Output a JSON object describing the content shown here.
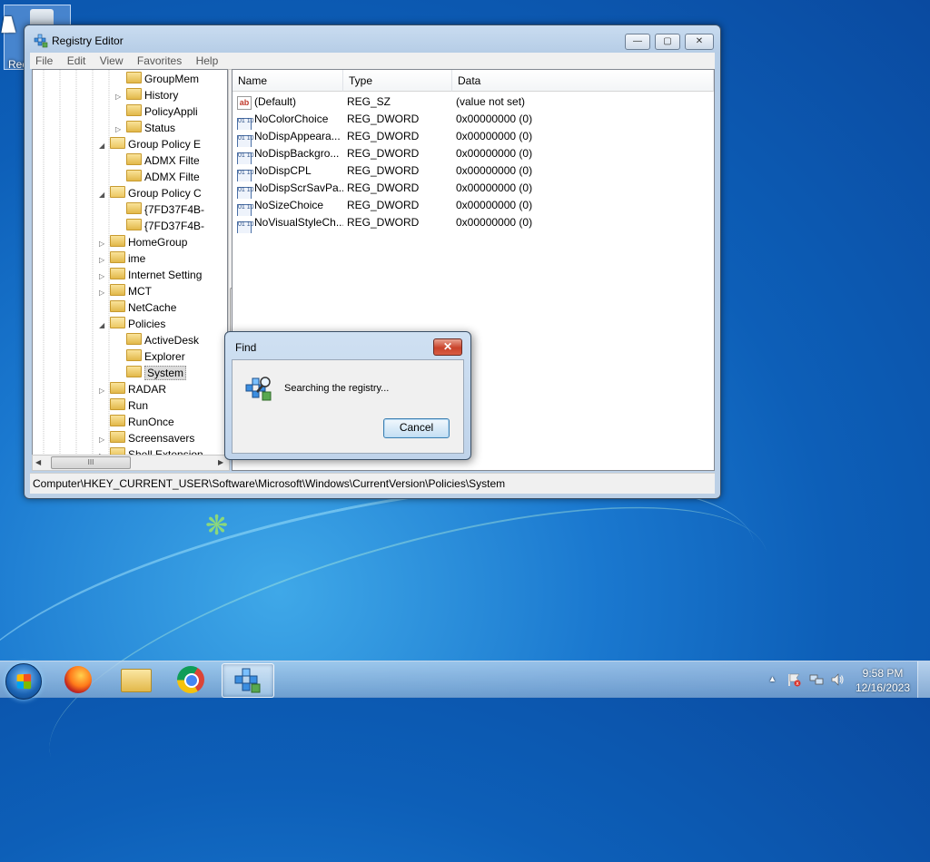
{
  "desktop": {
    "recycle_bin_label": "Rec"
  },
  "window": {
    "title": "Registry Editor",
    "buttons": {
      "minimize": "—",
      "maximize": "▢",
      "close": "✕"
    },
    "menu": [
      "File",
      "Edit",
      "View",
      "Favorites",
      "Help"
    ]
  },
  "tree": {
    "items": [
      {
        "label": "GroupMem",
        "level": 3,
        "arrow": "",
        "open": false
      },
      {
        "label": "History",
        "level": 3,
        "arrow": "▷",
        "open": false
      },
      {
        "label": "PolicyAppli",
        "level": 3,
        "arrow": "",
        "open": false
      },
      {
        "label": "Status",
        "level": 3,
        "arrow": "▷",
        "open": false
      },
      {
        "label": "Group Policy E",
        "level": 2,
        "arrow": "◢",
        "open": true
      },
      {
        "label": "ADMX Filte",
        "level": 3,
        "arrow": "",
        "open": false
      },
      {
        "label": "ADMX Filte",
        "level": 3,
        "arrow": "",
        "open": false
      },
      {
        "label": "Group Policy C",
        "level": 2,
        "arrow": "◢",
        "open": true
      },
      {
        "label": "{7FD37F4B-",
        "level": 3,
        "arrow": "",
        "open": false
      },
      {
        "label": "{7FD37F4B-",
        "level": 3,
        "arrow": "",
        "open": false
      },
      {
        "label": "HomeGroup",
        "level": 2,
        "arrow": "▷",
        "open": false
      },
      {
        "label": "ime",
        "level": 2,
        "arrow": "▷",
        "open": false
      },
      {
        "label": "Internet Setting",
        "level": 2,
        "arrow": "▷",
        "open": false
      },
      {
        "label": "MCT",
        "level": 2,
        "arrow": "▷",
        "open": false
      },
      {
        "label": "NetCache",
        "level": 2,
        "arrow": "",
        "open": false
      },
      {
        "label": "Policies",
        "level": 2,
        "arrow": "◢",
        "open": true
      },
      {
        "label": "ActiveDesk",
        "level": 3,
        "arrow": "",
        "open": false
      },
      {
        "label": "Explorer",
        "level": 3,
        "arrow": "",
        "open": false
      },
      {
        "label": "System",
        "level": 3,
        "arrow": "",
        "open": false,
        "selected": true
      },
      {
        "label": "RADAR",
        "level": 2,
        "arrow": "▷",
        "open": false
      },
      {
        "label": "Run",
        "level": 2,
        "arrow": "",
        "open": false
      },
      {
        "label": "RunOnce",
        "level": 2,
        "arrow": "",
        "open": false
      },
      {
        "label": "Screensavers",
        "level": 2,
        "arrow": "▷",
        "open": false
      },
      {
        "label": "Shell Extension",
        "level": 2,
        "arrow": "▷",
        "open": false
      }
    ],
    "scroll_thumb_glyph": "III"
  },
  "list": {
    "columns": [
      "Name",
      "Type",
      "Data"
    ],
    "rows": [
      {
        "name": "(Default)",
        "type": "REG_SZ",
        "data": "(value not set)",
        "icon": "string-value-icon"
      },
      {
        "name": "NoColorChoice",
        "type": "REG_DWORD",
        "data": "0x00000000 (0)",
        "icon": "dword-value-icon"
      },
      {
        "name": "NoDispAppeara...",
        "type": "REG_DWORD",
        "data": "0x00000000 (0)",
        "icon": "dword-value-icon"
      },
      {
        "name": "NoDispBackgro...",
        "type": "REG_DWORD",
        "data": "0x00000000 (0)",
        "icon": "dword-value-icon"
      },
      {
        "name": "NoDispCPL",
        "type": "REG_DWORD",
        "data": "0x00000000 (0)",
        "icon": "dword-value-icon"
      },
      {
        "name": "NoDispScrSavPa...",
        "type": "REG_DWORD",
        "data": "0x00000000 (0)",
        "icon": "dword-value-icon"
      },
      {
        "name": "NoSizeChoice",
        "type": "REG_DWORD",
        "data": "0x00000000 (0)",
        "icon": "dword-value-icon"
      },
      {
        "name": "NoVisualStyleCh...",
        "type": "REG_DWORD",
        "data": "0x00000000 (0)",
        "icon": "dword-value-icon"
      }
    ]
  },
  "status_bar": {
    "path": "Computer\\HKEY_CURRENT_USER\\Software\\Microsoft\\Windows\\CurrentVersion\\Policies\\System"
  },
  "find_dialog": {
    "title": "Find",
    "close_label": "✕",
    "message": "Searching the registry...",
    "cancel_label": "Cancel"
  },
  "taskbar": {
    "clock_time": "9:58 PM",
    "clock_date": "12/16/2023",
    "tray_arrow": "▲"
  },
  "colors": {
    "desktop_blue": "#1a78cf",
    "selection_gray": "#dcdcdc",
    "close_red": "#c9432b"
  }
}
